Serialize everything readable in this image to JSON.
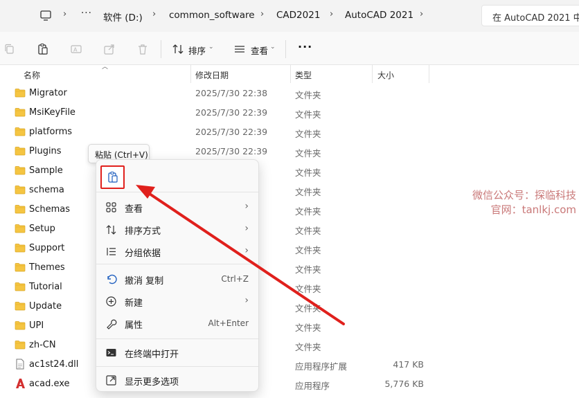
{
  "address": {
    "crumbs": [
      "软件 (D:)",
      "common_software",
      "CAD2021",
      "AutoCAD 2021"
    ],
    "more": "···",
    "search_placeholder": "在 AutoCAD 2021 中"
  },
  "toolbar": {
    "sort_label": "排序",
    "view_label": "查看",
    "more_label": "···"
  },
  "columns": {
    "name": "名称",
    "date": "修改日期",
    "type": "类型",
    "size": "大小"
  },
  "files": [
    {
      "name": "Migrator",
      "date": "2025/7/30 22:38",
      "type": "文件夹",
      "size": "",
      "icon": "folder-icon"
    },
    {
      "name": "MsiKeyFile",
      "date": "2025/7/30 22:39",
      "type": "文件夹",
      "size": "",
      "icon": "folder-icon"
    },
    {
      "name": "platforms",
      "date": "2025/7/30 22:39",
      "type": "文件夹",
      "size": "",
      "icon": "folder-icon"
    },
    {
      "name": "Plugins",
      "date": "2025/7/30 22:39",
      "type": "文件夹",
      "size": "",
      "icon": "folder-icon"
    },
    {
      "name": "Sample",
      "date": "",
      "type": "文件夹",
      "size": "",
      "icon": "folder-icon"
    },
    {
      "name": "schema",
      "date": "",
      "type": "文件夹",
      "size": "",
      "icon": "folder-icon"
    },
    {
      "name": "Schemas",
      "date": "",
      "type": "文件夹",
      "size": "",
      "icon": "folder-icon"
    },
    {
      "name": "Setup",
      "date": "",
      "type": "文件夹",
      "size": "",
      "icon": "folder-icon"
    },
    {
      "name": "Support",
      "date": "",
      "type": "文件夹",
      "size": "",
      "icon": "folder-icon"
    },
    {
      "name": "Themes",
      "date": "",
      "type": "文件夹",
      "size": "",
      "icon": "folder-icon"
    },
    {
      "name": "Tutorial",
      "date": "",
      "type": "文件夹",
      "size": "",
      "icon": "folder-icon"
    },
    {
      "name": "Update",
      "date": "",
      "type": "文件夹",
      "size": "",
      "icon": "folder-icon"
    },
    {
      "name": "UPI",
      "date": "",
      "type": "文件夹",
      "size": "",
      "icon": "folder-icon"
    },
    {
      "name": "zh-CN",
      "date": "",
      "type": "文件夹",
      "size": "",
      "icon": "folder-icon"
    },
    {
      "name": "ac1st24.dll",
      "date": "",
      "type": "应用程序扩展",
      "size": "417 KB",
      "icon": "dll-file-icon"
    },
    {
      "name": "acad.exe",
      "date": "",
      "type": "应用程序",
      "size": "5,776 KB",
      "icon": "autocad-app-icon"
    }
  ],
  "tooltip": "粘贴 (Ctrl+V)",
  "context_menu": {
    "items": [
      {
        "label": "查看",
        "shortcut": "",
        "submenu": true,
        "icon": "grid-icon"
      },
      {
        "label": "排序方式",
        "shortcut": "",
        "submenu": true,
        "icon": "sort-icon"
      },
      {
        "label": "分组依据",
        "shortcut": "",
        "submenu": true,
        "icon": "group-list-icon"
      },
      {
        "label": "撤消 复制",
        "shortcut": "Ctrl+Z",
        "submenu": false,
        "icon": "undo-icon"
      },
      {
        "label": "新建",
        "shortcut": "",
        "submenu": true,
        "icon": "new-plus-icon"
      },
      {
        "label": "属性",
        "shortcut": "Alt+Enter",
        "submenu": false,
        "icon": "wrench-icon"
      },
      {
        "label": "在终端中打开",
        "shortcut": "",
        "submenu": false,
        "icon": "terminal-icon"
      },
      {
        "label": "显示更多选项",
        "shortcut": "",
        "submenu": false,
        "icon": "more-options-icon"
      }
    ],
    "submenu_arrow": "›"
  },
  "watermark": {
    "line1": "微信公众号：探临科技",
    "line2": "官网：tanlkj.com"
  },
  "colors": {
    "accent": "#1f5fbf",
    "folder": "#f5c542",
    "highlight_red": "#e0201c"
  }
}
